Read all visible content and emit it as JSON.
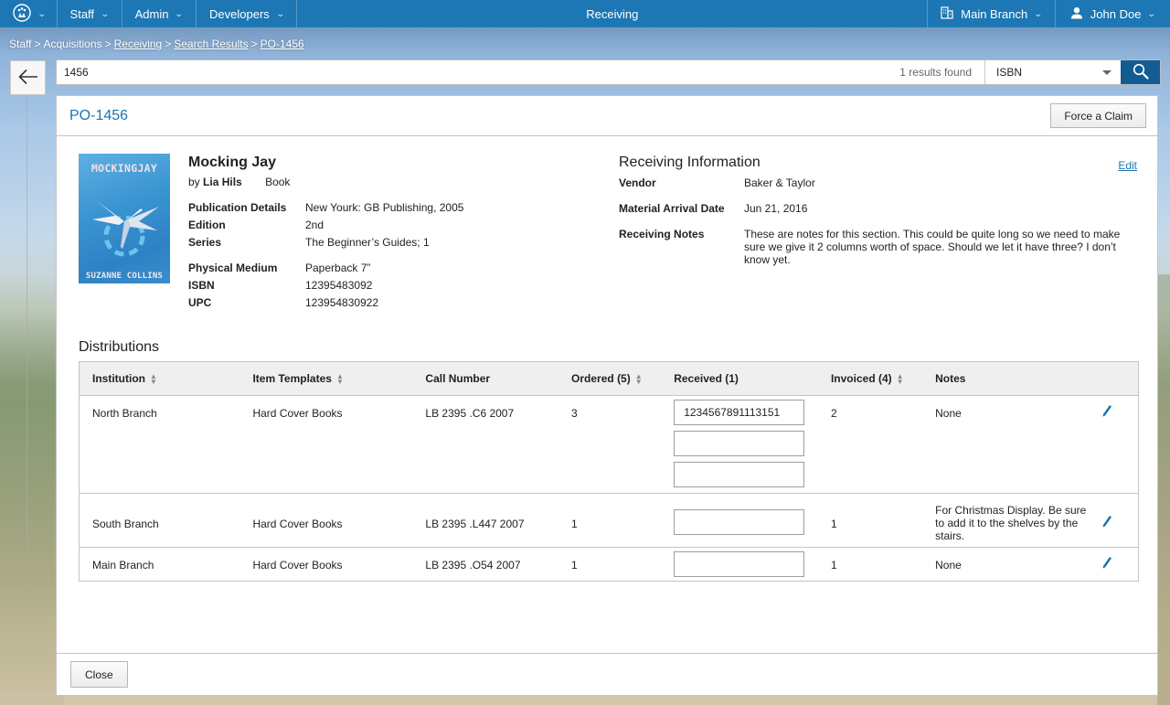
{
  "nav": {
    "logo_icon": "app-logo-icon",
    "items": [
      {
        "label": "Staff"
      },
      {
        "label": "Admin"
      },
      {
        "label": "Developers"
      }
    ],
    "title": "Receiving",
    "branch": {
      "icon": "building-icon",
      "label": "Main Branch"
    },
    "user": {
      "icon": "user-icon",
      "label": "John Doe"
    }
  },
  "breadcrumb": {
    "items": [
      {
        "label": "Staff",
        "link": false
      },
      {
        "label": "Acquisitions",
        "link": false
      },
      {
        "label": "Receiving",
        "link": true
      },
      {
        "label": "Search Results",
        "link": true
      },
      {
        "label": "PO-1456",
        "link": true
      }
    ],
    "separator": ">"
  },
  "search": {
    "value": "1456",
    "placeholder": "",
    "results_text": "1 results found",
    "type_selected": "ISBN"
  },
  "panel": {
    "title": "PO-1456",
    "force_claim_label": "Force a Claim",
    "close_label": "Close"
  },
  "book": {
    "cover": {
      "title": "MOCKINGJAY",
      "author": "SUZANNE COLLINS"
    },
    "title": "Mocking Jay",
    "by_prefix": "by",
    "author": "Lia Hils",
    "format": "Book",
    "details": [
      {
        "label": "Publication Details",
        "value": "New Yourk: GB Publishing, 2005"
      },
      {
        "label": "Edition",
        "value": "2nd"
      },
      {
        "label": "Series",
        "value": "The Beginner’s Guides; 1"
      }
    ],
    "physical": [
      {
        "label": "Physical Medium",
        "value": "Paperback 7”"
      },
      {
        "label": "ISBN",
        "value": "12395483092"
      },
      {
        "label": "UPC",
        "value": "123954830922"
      }
    ]
  },
  "receiving": {
    "title": "Receiving Information",
    "edit_label": "Edit",
    "fields": [
      {
        "label": "Vendor",
        "value": "Baker & Taylor"
      },
      {
        "label": "Material Arrival Date",
        "value": "Jun 21, 2016"
      },
      {
        "label": "Receiving Notes",
        "value": "These are notes for this section.  This could be quite long so we need to make sure we give it 2 columns worth of space.  Should we let it have three?  I don’t know yet."
      }
    ]
  },
  "distributions": {
    "title": "Distributions",
    "columns": [
      {
        "label": "Institution",
        "sortable": true
      },
      {
        "label": "Item Templates",
        "sortable": true
      },
      {
        "label": "Call Number",
        "sortable": false
      },
      {
        "label": "Ordered (5)",
        "sortable": true
      },
      {
        "label": "Received (1)",
        "sortable": false
      },
      {
        "label": "Invoiced (4)",
        "sortable": true
      },
      {
        "label": "Notes",
        "sortable": false
      }
    ],
    "rows": [
      {
        "institution": "North Branch",
        "template": "Hard Cover Books",
        "call_number": "LB 2395 .C6 2007",
        "ordered": "3",
        "received": [
          "1234567891113151",
          "",
          ""
        ],
        "invoiced": "2",
        "notes": "None"
      },
      {
        "institution": "South Branch",
        "template": "Hard Cover Books",
        "call_number": "LB 2395 .L447 2007",
        "ordered": "1",
        "received": [
          ""
        ],
        "invoiced": "1",
        "notes": "For Christmas Display.  Be sure to add it to the shelves by the stairs."
      },
      {
        "institution": "Main Branch",
        "template": "Hard Cover Books",
        "call_number": "LB 2395 .O54 2007",
        "ordered": "1",
        "received": [
          ""
        ],
        "invoiced": "1",
        "notes": "None"
      }
    ]
  },
  "colors": {
    "nav_bg": "#1c77b4",
    "accent": "#1b75b1",
    "search_button": "#125c94"
  }
}
